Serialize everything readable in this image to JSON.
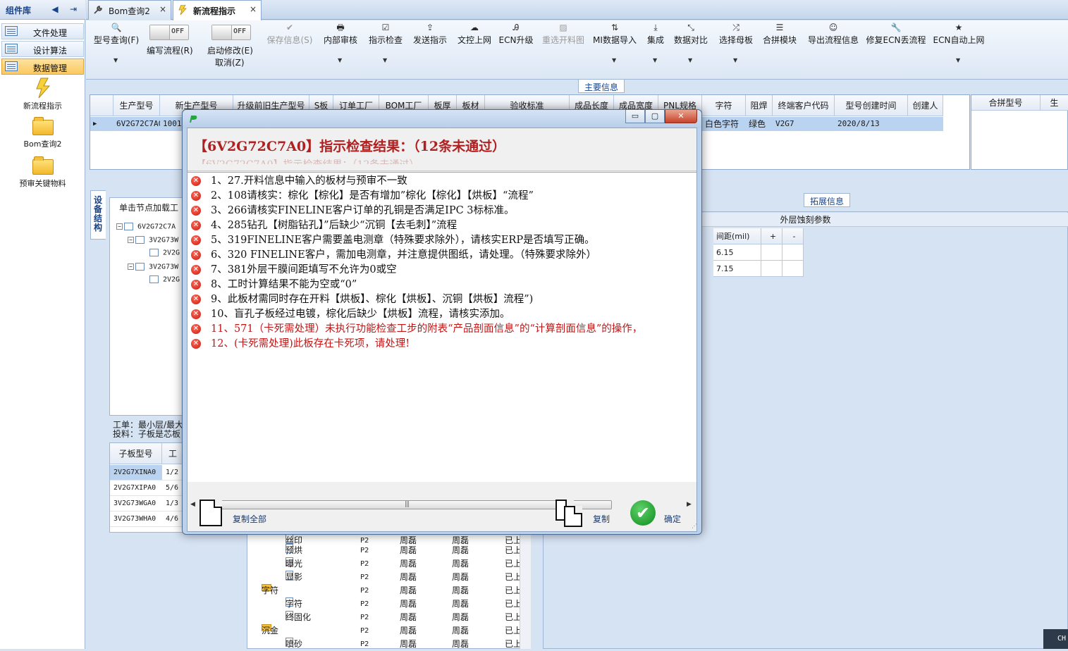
{
  "left_panel": {
    "title": "组件库",
    "prev_arrow": "◀",
    "pin_icon": "⇥",
    "nav_items": [
      {
        "label": "文件处理",
        "active": false
      },
      {
        "label": "设计算法",
        "active": false
      },
      {
        "label": "数据管理",
        "active": true
      }
    ],
    "tools": [
      {
        "label": "新流程指示",
        "icon": "lightning-icon"
      },
      {
        "label": "Bom查询2",
        "icon": "folder-icon"
      },
      {
        "label": "预审关键物料",
        "icon": "folder-icon"
      }
    ]
  },
  "tabs": [
    {
      "label": "Bom查询2",
      "close": "×",
      "active": false
    },
    {
      "label": "新流程指示",
      "close": "×",
      "active": true
    }
  ],
  "toolbar": {
    "model_query": {
      "icon": "🔍",
      "label": "型号查询(F)",
      "arrow": "▼"
    },
    "edit_flow": {
      "toggle": "OFF",
      "label": "编写流程(R)"
    },
    "start_modify": {
      "toggle": "OFF",
      "label": "启动修改(E)",
      "sub": "取消(Z)"
    },
    "buttons": [
      {
        "icon": "✔",
        "label": "保存信息(S)",
        "disabled": true,
        "arrow": ""
      },
      {
        "icon": "🖶",
        "label": "内部审核",
        "disabled": false,
        "arrow": "▼"
      },
      {
        "icon": "☑",
        "label": "指示检查",
        "disabled": false,
        "arrow": "▼"
      },
      {
        "icon": "⇪",
        "label": "发送指示",
        "disabled": false,
        "arrow": ""
      },
      {
        "icon": "☁",
        "label": "文控上网",
        "disabled": false,
        "arrow": ""
      },
      {
        "icon": "Ꭿ",
        "label": "ECN升级",
        "disabled": false,
        "arrow": ""
      },
      {
        "icon": "▨",
        "label": "重选开料图",
        "disabled": true,
        "arrow": ""
      },
      {
        "icon": "⇅",
        "label": "MI数据导入",
        "disabled": false,
        "arrow": "▼"
      },
      {
        "icon": "⤓",
        "label": "集成",
        "disabled": false,
        "arrow": "▼"
      },
      {
        "icon": "⤡",
        "label": "数据对比",
        "disabled": false,
        "arrow": "▼"
      },
      {
        "icon": "⤮",
        "label": "选择母板",
        "disabled": false,
        "arrow": "▼"
      },
      {
        "icon": "☰",
        "label": "合拼模块",
        "disabled": false,
        "arrow": ""
      },
      {
        "icon": "☺",
        "label": "导出流程信息",
        "disabled": false,
        "arrow": ""
      },
      {
        "icon": "🔧",
        "label": "修复ECN丢流程",
        "disabled": false,
        "arrow": ""
      },
      {
        "icon": "★",
        "label": "ECN自动上网",
        "disabled": false,
        "arrow": "▼"
      }
    ]
  },
  "main_info": {
    "group_title": "主要信息",
    "columns": [
      "生产型号",
      "新生产型号",
      "升级前旧生产型号",
      "S板",
      "订单工厂",
      "BOM工厂",
      "板厚",
      "板材",
      "验收标准",
      "成品长度",
      "成品宽度",
      "PNL规格",
      "字符",
      "阻焊",
      "终端客户代码",
      "型号创建时间",
      "创建人"
    ],
    "row": {
      "prod_model": "6V2G72C7A0",
      "new_model": "1001",
      "char": "白色字符",
      "solder": "绿色",
      "customer_code": "V2G7",
      "created": "2020/8/13"
    },
    "row_marker": "▶",
    "right_columns": [
      "合拼型号",
      "生"
    ]
  },
  "lower": {
    "vertical_tab": "设备结构",
    "tree_hint": "单击节点加载工",
    "tree_nodes": [
      "6V2G72C7A",
      "3V2G73W",
      "2V2G",
      "3V2G73W",
      "2V2G"
    ],
    "info_line1": "工单：最小层/最大",
    "info_line2": "投料：子板是芯板",
    "sub_grid_cols": [
      "子板型号",
      "工"
    ],
    "sub_grid_rows": [
      {
        "model": "2V2G7XINA0",
        "v": "1/2"
      },
      {
        "model": "2V2G7XIPA0",
        "v": "5/6"
      },
      {
        "model": "3V2G73WGA0",
        "v": "1/3"
      },
      {
        "model": "3V2G73WHA0",
        "v": "4/6"
      }
    ],
    "bottom_tree": [
      {
        "name": "丝印",
        "type": "file",
        "p": "P2",
        "a": "周磊",
        "b": "周磊",
        "s": "已上"
      },
      {
        "name": "预烘",
        "type": "file",
        "p": "P2",
        "a": "周磊",
        "b": "周磊",
        "s": "已上"
      },
      {
        "name": "曝光",
        "type": "file",
        "p": "P2",
        "a": "周磊",
        "b": "周磊",
        "s": "已上"
      },
      {
        "name": "显影",
        "type": "file",
        "p": "P2",
        "a": "周磊",
        "b": "周磊",
        "s": "已上"
      },
      {
        "name": "字符",
        "type": "folder",
        "p": "P2",
        "a": "周磊",
        "b": "周磊",
        "s": "已上"
      },
      {
        "name": "字符",
        "type": "file",
        "p": "P2",
        "a": "周磊",
        "b": "周磊",
        "s": "已上"
      },
      {
        "name": "终固化",
        "type": "file",
        "p": "P2",
        "a": "周磊",
        "b": "周磊",
        "s": "已上"
      },
      {
        "name": "沉金",
        "type": "folder",
        "p": "P2",
        "a": "周磊",
        "b": "周磊",
        "s": "已上"
      },
      {
        "name": "喷砂",
        "type": "file",
        "p": "P2",
        "a": "周磊",
        "b": "周磊",
        "s": "已上"
      }
    ],
    "ext_title": "拓展信息",
    "ext_head": "外层蚀刻参数",
    "ext_cols": [
      "间距(mil)",
      "+",
      "-"
    ],
    "ext_rows": [
      "6.15",
      "7.15"
    ]
  },
  "dialog": {
    "heading": "【6V2G72C7A0】指示检查结果：（12条未通过）",
    "heading_ghost": "【6V2G72C7A0】指示检查结果：（12条未通过）",
    "min_btn": "▭",
    "max_btn": "▢",
    "close_btn": "✕",
    "error_icon": "✕",
    "items": [
      {
        "text": "1、27.开料信息中输入的板材与预审不一致",
        "red": false
      },
      {
        "text": "2、108请核实：棕化【棕化】是否有增加”棕化【棕化】【烘板】“流程”",
        "red": false
      },
      {
        "text": "3、266请核实FINELINE客户订单的孔铜是否满足IPC 3标标准。",
        "red": false
      },
      {
        "text": "4、285钻孔【树脂钻孔】”后缺少“沉铜【去毛刺】”流程",
        "red": false
      },
      {
        "text": "5、319FINELINE客户需要盖电测章（特殊要求除外），请核实ERP是否填写正确。",
        "red": false
      },
      {
        "text": "6、320 FINELINE客户，需加电测章，并注意提供图纸，请处理。（特殊要求除外）",
        "red": false
      },
      {
        "text": "7、381外层干膜间距填写不允许为0或空",
        "red": false
      },
      {
        "text": "8、工时计算结果不能为空或“0”",
        "red": false
      },
      {
        "text": "9、此板材需同时存在开料【烘板】、棕化【烘板】、沉铜【烘板】流程”)",
        "red": false
      },
      {
        "text": "10、盲孔子板经过电镀，棕化后缺少【烘板】流程，请核实添加。",
        "red": false
      },
      {
        "text": "11、571（卡死需处理）未执行功能检查工步的附表“产品剖面信息”的“计算剖面信息”的操作，",
        "red": true
      },
      {
        "text": "12、(卡死需处理)此板存在卡死项，请处理!",
        "red": true
      }
    ],
    "scroll_left": "◀",
    "scroll_right": "▶",
    "scroll_grip": "|||",
    "copy_all_label": "复制全部",
    "copy_label": "复制",
    "ok_label": "确定",
    "ok_icon": "✔",
    "resize_grip": "⋰"
  },
  "status": {
    "ime": "CH"
  },
  "colors": {
    "accent": "#15428b",
    "error": "#c31414",
    "active_nav": "#fbc85f",
    "ok": "#0d8a1c"
  }
}
